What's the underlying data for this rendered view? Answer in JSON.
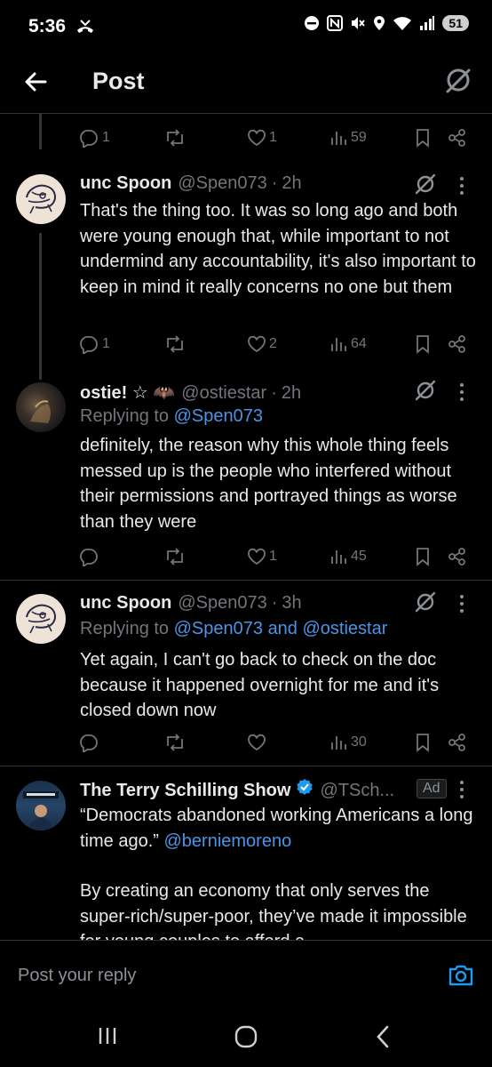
{
  "status_bar": {
    "time": "5:36",
    "battery": "51"
  },
  "header": {
    "title": "Post"
  },
  "parent_actions": {
    "replies": "1",
    "retweets": "",
    "likes": "1",
    "views": "59"
  },
  "tweets": [
    {
      "name": "unc Spoon",
      "handle": "@Spen073",
      "dot": "·",
      "time": "2h",
      "body": "That's the thing too. It was so long ago and both were young enough that, while important to not undermind any accountability, it's also important to keep in mind it really concerns no one but them",
      "actions": {
        "replies": "1",
        "retweets": "",
        "likes": "2",
        "views": "64"
      }
    },
    {
      "name": "ostie! ☆ 🦇",
      "handle": "@ostiestar",
      "dot": "·",
      "time": "2h",
      "replying_prefix": "Replying to ",
      "replying_to": "@Spen073",
      "body": "definitely, the reason why this whole thing feels messed up is the people who interfered without their permissions and portrayed things as worse than they were",
      "actions": {
        "replies": "",
        "retweets": "",
        "likes": "1",
        "views": "45"
      }
    },
    {
      "name": "unc Spoon",
      "handle": "@Spen073",
      "dot": "·",
      "time": "3h",
      "replying_prefix": "Replying to ",
      "replying_to": "@Spen073 and @ostiestar",
      "body": "Yet again, I can't go back to check on the doc because it happened overnight for me and it's closed down now",
      "actions": {
        "replies": "",
        "retweets": "",
        "likes": "",
        "views": "30"
      }
    },
    {
      "name": "The Terry Schilling Show",
      "handle": "@TSch...",
      "ad_label": "Ad",
      "body_part1": "“Democrats abandoned working Americans a long time ago.” ",
      "body_mention": "@berniemoreno",
      "body_part2": "By creating an economy that only serves the super-rich/super-poor, they’ve made it impossible for young couples to afford a"
    }
  ],
  "reply_bar": {
    "placeholder": "Post your reply"
  },
  "icons": {
    "reply": "reply-icon",
    "retweet": "retweet-icon",
    "like": "like-icon",
    "views": "views-icon",
    "bookmark": "bookmark-icon",
    "share": "share-icon",
    "grok": "grok-icon",
    "more": "more-icon",
    "verified": "verified-badge-icon",
    "camera": "camera-icon"
  },
  "colors": {
    "background": "#000000",
    "text": "#e7e9ea",
    "muted": "#71767b",
    "link": "#4a95e6",
    "verified": "#1d9bf0"
  }
}
